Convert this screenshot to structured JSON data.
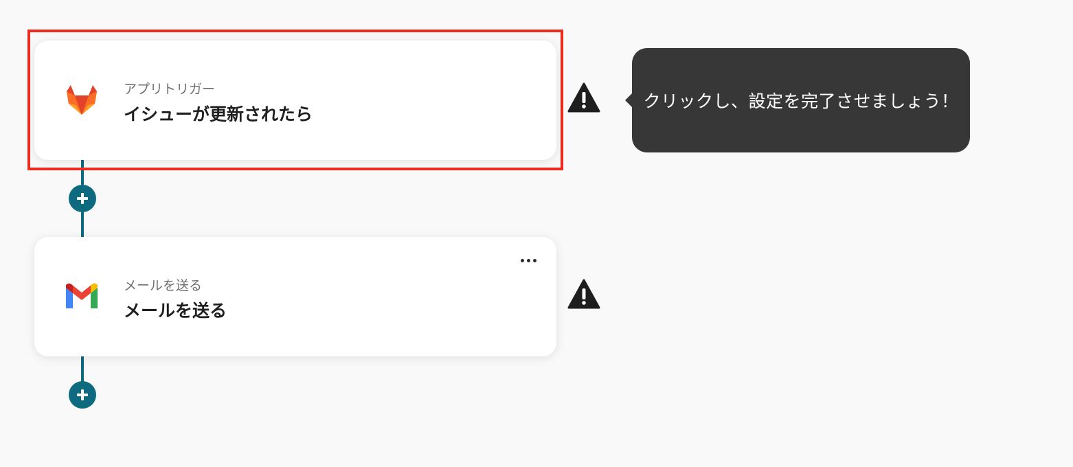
{
  "flow": {
    "steps": [
      {
        "subtitle": "アプリトリガー",
        "title": "イシューが更新されたら",
        "icon": "gitlab-icon",
        "status_icon": "warning-icon"
      },
      {
        "subtitle": "メールを送る",
        "title": "メールを送る",
        "icon": "gmail-icon",
        "status_icon": "warning-icon",
        "menu_icon": "more-icon"
      }
    ]
  },
  "tooltip": {
    "text": "クリックし、設定を完了させましょう！"
  },
  "colors": {
    "connector": "#0e6a7e",
    "highlight": "#ec2b1f",
    "tooltip_bg": "#373737"
  }
}
